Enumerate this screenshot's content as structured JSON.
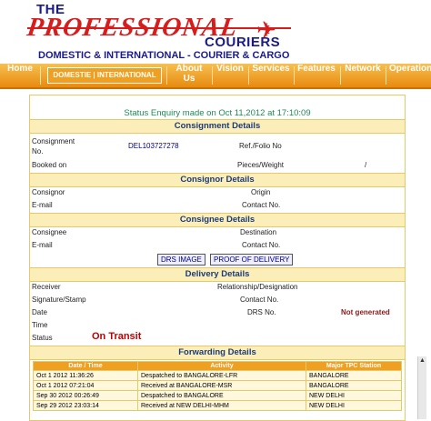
{
  "logo": {
    "the": "THE",
    "professional": "PROFESSIONAL",
    "couriers": "COURIERS",
    "tagline": "DOMESTIC & INTERNATIONAL  -  COURIER & CARGO"
  },
  "nav": {
    "items": [
      "Home",
      "DOMESTIE | INTERNATIONAL",
      "About Us",
      "Vision",
      "Services",
      "Features",
      "Network",
      "Operation"
    ]
  },
  "status_enquiry": "Status Enquiry made on Oct 11,2012 at 17:10:09",
  "consignment": {
    "title": "Consignment Details",
    "consignment_no_label": "Consignment No.",
    "consignment_no_value": "DEL103727278",
    "ref_label": "Ref./Folio No",
    "booked_on_label": "Booked on",
    "pieces_label": "Pieces/Weight",
    "pieces_value": "/"
  },
  "consignor": {
    "title": "Consignor Details",
    "consignor_label": "Consignor",
    "origin_label": "Origin",
    "email_label": "E-mail",
    "contact_label": "Contact No."
  },
  "consignee": {
    "title": "Consignee Details",
    "consignee_label": "Consignee",
    "destination_label": "Destination",
    "email_label": "E-mail",
    "contact_label": "Contact No."
  },
  "buttons": {
    "drs_image": "DRS IMAGE",
    "proof_of_delivery": "PROOF OF DELIVERY"
  },
  "delivery": {
    "title": "Delivery Details",
    "receiver_label": "Receiver",
    "relationship_label": "Relationship/Designation",
    "signature_label": "Signature/Stamp",
    "contact_label": "Contact No.",
    "date_label": "Date",
    "drs_label": "DRS No.",
    "drs_value": "Not generated",
    "time_label": "Time",
    "status_label": "Status",
    "status_value": "On Transit"
  },
  "forwarding": {
    "title": "Forwarding Details",
    "headers": [
      "Date / Time",
      "Activity",
      "Major TPC Station"
    ],
    "rows": [
      [
        "Oct 1 2012 11:36:26",
        "Despatched to BANGALORE-LFR",
        "BANGALORE"
      ],
      [
        "Oct 1 2012 07:21:04",
        "Received at BANGALORE-MSR",
        "BANGALORE"
      ],
      [
        "Sep 30 2012 00:26:49",
        "Despatched to BANGALORE",
        "NEW DELHI"
      ],
      [
        "Sep 29 2012 23:03:14",
        "Received at NEW DELHI-MHM",
        "NEW DELHI"
      ]
    ]
  },
  "colors": {
    "brand_red": "#d81c1c",
    "brand_blue": "#1a1a8c",
    "nav_orange": "#e88a10",
    "section_bg": "#fbeeb8",
    "status_green": "#1e8a5a"
  }
}
